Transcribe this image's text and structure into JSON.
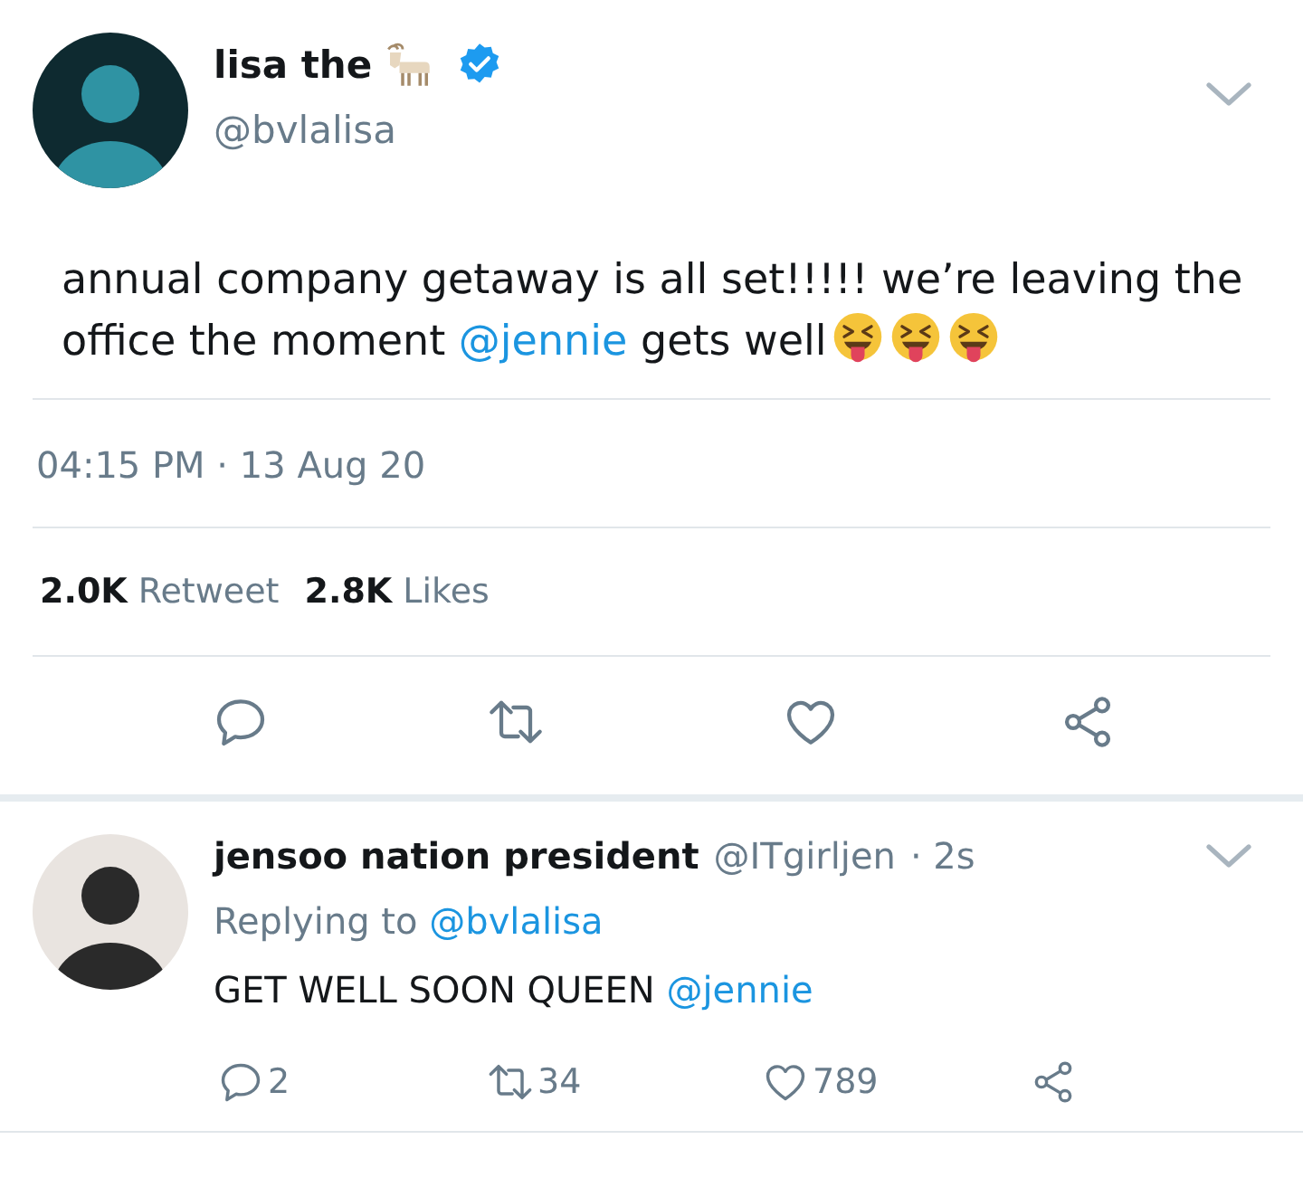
{
  "tweet": {
    "name": "lisa the",
    "verified": true,
    "handle": "@bvlalisa",
    "text": [
      {
        "kind": "plain",
        "text": "annual company getaway is all set!!!!! we’re leaving the office the moment "
      },
      {
        "kind": "mention",
        "text": "@jennie"
      },
      {
        "kind": "plain",
        "text": " gets well"
      }
    ],
    "emojis": [
      {
        "kind": "tongue_face"
      },
      {
        "kind": "tongue_face"
      },
      {
        "kind": "tongue_face"
      }
    ],
    "timestamp": "04:15 PM · 13 Aug 20",
    "stats": [
      {
        "count": "2.0K",
        "label": "Retweet"
      },
      {
        "count": "2.8K",
        "label": "Likes"
      }
    ]
  },
  "reply": {
    "name": "jensoo nation president",
    "handle": "@ITgirljen",
    "time": "· 2s",
    "replying_label": "Replying to",
    "replying_to": "@bvlalisa",
    "text": [
      {
        "kind": "plain",
        "text": "GET WELL SOON QUEEN "
      },
      {
        "kind": "mention",
        "text": "@jennie"
      }
    ],
    "actions": [
      {
        "kind": "reply",
        "count": "2"
      },
      {
        "kind": "retweet",
        "count": "34"
      },
      {
        "kind": "like",
        "count": "789"
      },
      {
        "kind": "share"
      }
    ]
  }
}
